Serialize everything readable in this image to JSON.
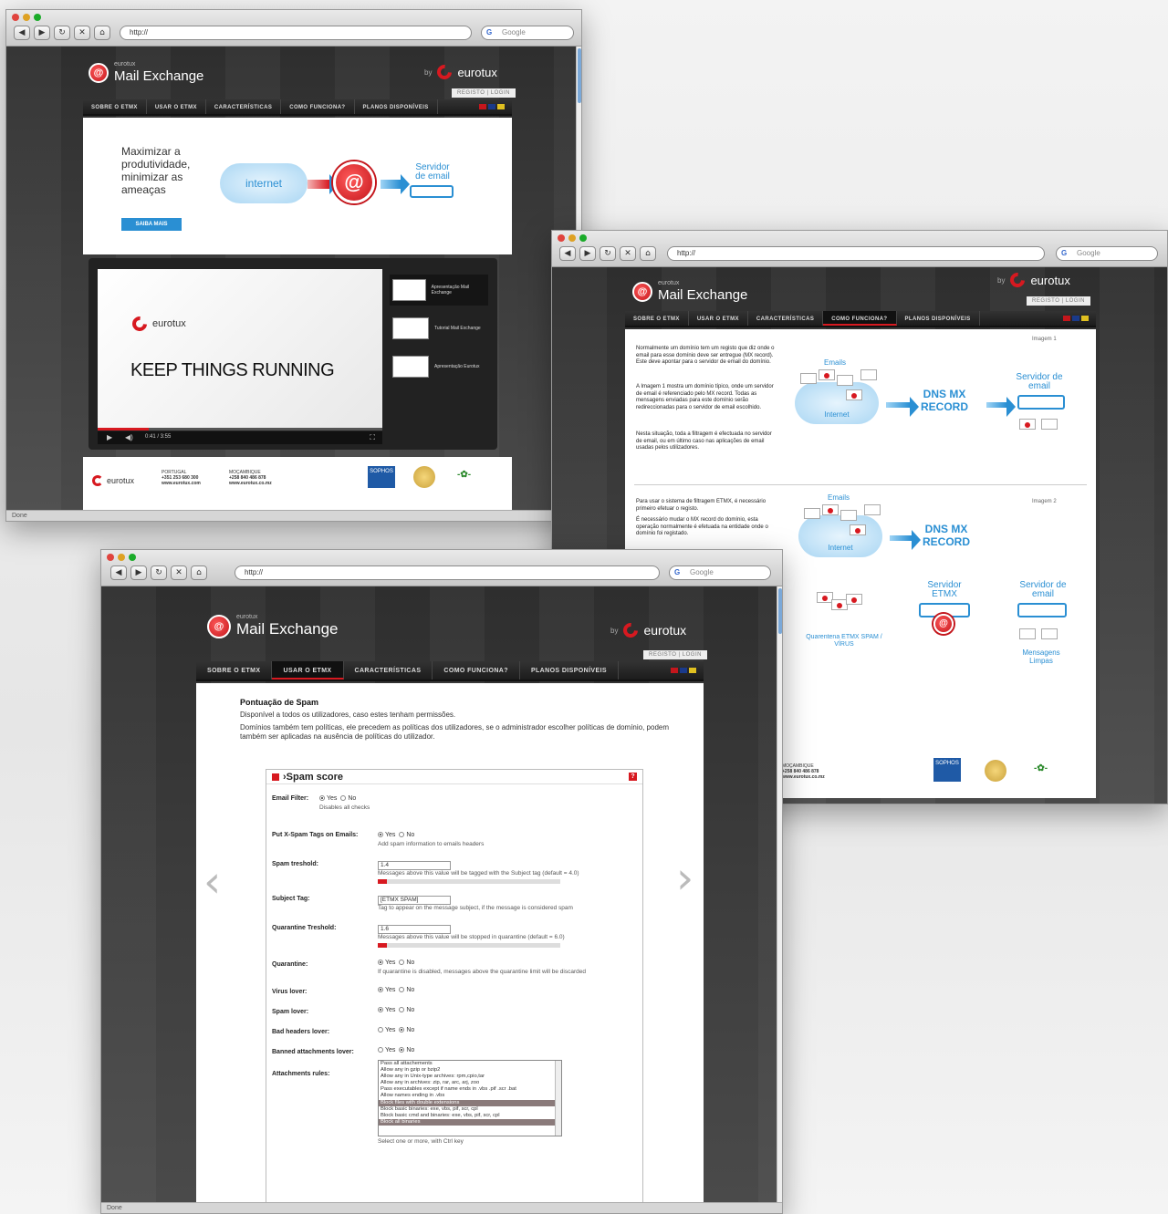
{
  "browser": {
    "url_text": "http://",
    "search_placeholder": "Google",
    "search_g": "G",
    "status_text": "Done",
    "bookmark_icon": "star-icon"
  },
  "site": {
    "brand_small": "eurotux",
    "brand_name": "Mail Exchange",
    "by_label": "by",
    "company": "eurotux",
    "registo_label": "REGISTO | LOGIN",
    "menu": [
      "SOBRE O ETMX",
      "USAR O ETMX",
      "CARACTERÍSTICAS",
      "COMO FUNCIONA?",
      "PLANOS DISPONÍVEIS"
    ],
    "colors": {
      "accent": "#d71920",
      "blue": "#2a8fd3"
    }
  },
  "win1": {
    "hero": "Maximizar a produtividade, minimizar as ameaças",
    "cta": "SAIBA MAIS",
    "cloud_label": "internet",
    "server_label": "Servidor de email",
    "video_brand": "eurotux",
    "video_title": "KEEP THINGS RUNNING",
    "video_time": "0:41 / 3:55",
    "video_progress": 0.18,
    "thumbs": [
      {
        "label": "Apresentação Mail Exchange"
      },
      {
        "label": "Tutorial Mail Exchange"
      },
      {
        "label": "Apresentação Eurotux"
      }
    ],
    "footer": {
      "pt_title": "PORTUGAL",
      "pt_phone": "+351 253 680 300",
      "pt_site": "www.eurotux.com",
      "mz_title": "MOÇAMBIQUE",
      "mz_phone": "+258 840 486 878",
      "mz_site": "www.eurotux.co.mz",
      "sophos": "SOPHOS"
    }
  },
  "win2": {
    "img1_label": "Imagem 1",
    "img2_label": "Imagem 2",
    "para1": "Normalmente um domínio tem um registo que diz onde o email para esse domínio deve ser entregue (MX record). Este deve apontar para o servidor de email do domínio.",
    "para2": "A Imagem 1 mostra um domínio típico, onde um servidor de email é referenciado pelo MX record. Todas as mensagens enviadas para este domínio serão redireccionadas para o servidor de email escolhido.",
    "para3": "Nesta situação, toda a filtragem é efectuada no servidor de email, ou em último caso nas aplicações de email usadas pelos utilizadores.",
    "para4": "Para usar o sistema de filtragem ETMX, é necessário primeiro efetuar o registo.",
    "para5": "É necessário mudar o MX record do domínio, esta operação normalmente é efetuada na entidade onde o domínio foi registado.",
    "emails": "Emails",
    "internet": "Internet",
    "dns": "DNS MX RECORD",
    "servidor_email": "Servidor de email",
    "servidor_etmx": "Servidor ETMX",
    "quarentena": "Quarentena ETMX SPAM / VÍRUS",
    "limpas": "Mensagens Limpas",
    "footer_mz": "MOÇAMBIQUE",
    "footer_phone": "+258 840 486 878",
    "footer_site": "www.eurotux.co.mz",
    "sophos": "SOPHOS"
  },
  "win3": {
    "section_title": "Pontuação de Spam",
    "line1": "Disponível a todos os utilizadores, caso estes tenham permissões.",
    "line2": "Domínios também tem políticas, ele precedem as políticas dos utilizadores, se o administrador escolher políticas de domínio, podem também ser aplicadas na ausência de políticas do utilizador.",
    "panel_title": "›Spam score",
    "help": "?",
    "yes": "Yes",
    "no": "No",
    "fields": {
      "email_filter": {
        "label": "Email Filter:",
        "hint": "Disables all checks"
      },
      "xspam": {
        "label": "Put X-Spam Tags on Emails:",
        "hint": "Add spam information to emails headers"
      },
      "spam_treshold": {
        "label": "Spam treshold:",
        "value": "1.4",
        "hint": "Messages above this value will be tagged with the Subject tag (default = 4.0)",
        "level": 0.05
      },
      "subject_tag": {
        "label": "Subject Tag:",
        "value": "[ETMX SPAM]",
        "hint": "Tag to appear on the message subject, if the message is considered spam"
      },
      "quarantine_treshold": {
        "label": "Quarantine Treshold:",
        "value": "1.6",
        "hint": "Messages above this value will be stopped in quarantine (default = 6.0)",
        "level": 0.05
      },
      "quarantine": {
        "label": "Quarantine:",
        "hint": "If quarantine is disabled, messages above the quarantine limit will be discarded"
      },
      "virus_lover": {
        "label": "Virus lover:"
      },
      "spam_lover": {
        "label": "Spam lover:"
      },
      "bad_headers_lover": {
        "label": "Bad headers lover:"
      },
      "banned_lover": {
        "label": "Banned attachments lover:"
      },
      "attachments": {
        "label": "Attachments rules:",
        "hint": "Select one or more, with Ctrl key"
      }
    },
    "attachment_rules": [
      {
        "text": "Pass all attachements",
        "selected": false
      },
      {
        "text": "Allow any in gzip or bzip2",
        "selected": false
      },
      {
        "text": "Allow any in Unix-type archives: rpm,cpio,tar",
        "selected": false
      },
      {
        "text": "Allow any in archives: zip, rar, arc, arj, zoo",
        "selected": false
      },
      {
        "text": "Pass executables except if name ends in .vbs .pif .scr .bat",
        "selected": false
      },
      {
        "text": "Allow names ending in .vbs",
        "selected": false
      },
      {
        "text": "Block files with double extensions",
        "selected": true
      },
      {
        "text": "Block basic binaries: exe, vbs, pif, scr, cpl",
        "selected": false
      },
      {
        "text": "Block basic cmd and binaries: exe, vbs, pif, scr, cpl",
        "selected": false
      },
      {
        "text": "Block all binaries",
        "selected": true
      }
    ],
    "nav_prev_icon": "chevron-left-icon",
    "nav_next_icon": "chevron-right-icon"
  }
}
